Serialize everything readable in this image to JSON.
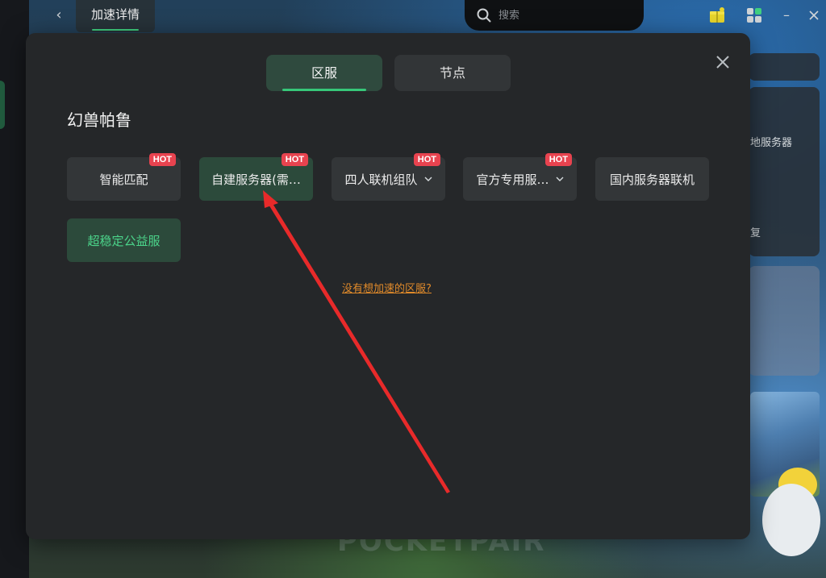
{
  "header": {
    "back_label": "‹",
    "title": "加速详情",
    "search_placeholder": "搜索",
    "minimize": "–"
  },
  "background": {
    "peek_text_1": "地服务器",
    "peek_text_2": "复",
    "brand": "POCKETPAIR"
  },
  "modal": {
    "tabs": [
      {
        "label": "区服",
        "active": true
      },
      {
        "label": "节点",
        "active": false
      }
    ],
    "game_title": "幻兽帕鲁",
    "hot_badge": "HOT",
    "servers": [
      {
        "label": "智能匹配",
        "hot": true
      },
      {
        "label": "自建服务器(需…",
        "hot": true,
        "selected": true
      },
      {
        "label": "四人联机组队",
        "hot": true,
        "dropdown": true
      },
      {
        "label": "官方专用服…",
        "hot": true,
        "dropdown": true
      },
      {
        "label": "国内服务器联机",
        "hot": false
      },
      {
        "label": "超稳定公益服",
        "hot": false,
        "highlight": "green"
      }
    ],
    "help_link": "没有想加速的区服?"
  },
  "colors": {
    "accent_green": "#37c779",
    "hot_red": "#e8434f",
    "link_orange": "#e08a2a",
    "modal_bg": "#252729",
    "arrow_red": "#e82a2a"
  },
  "icons": {
    "search": "search-icon",
    "gift": "gift-box-icon",
    "apps": "apps-grid-icon",
    "close": "close-icon",
    "chevron": "chevron-down-icon"
  }
}
